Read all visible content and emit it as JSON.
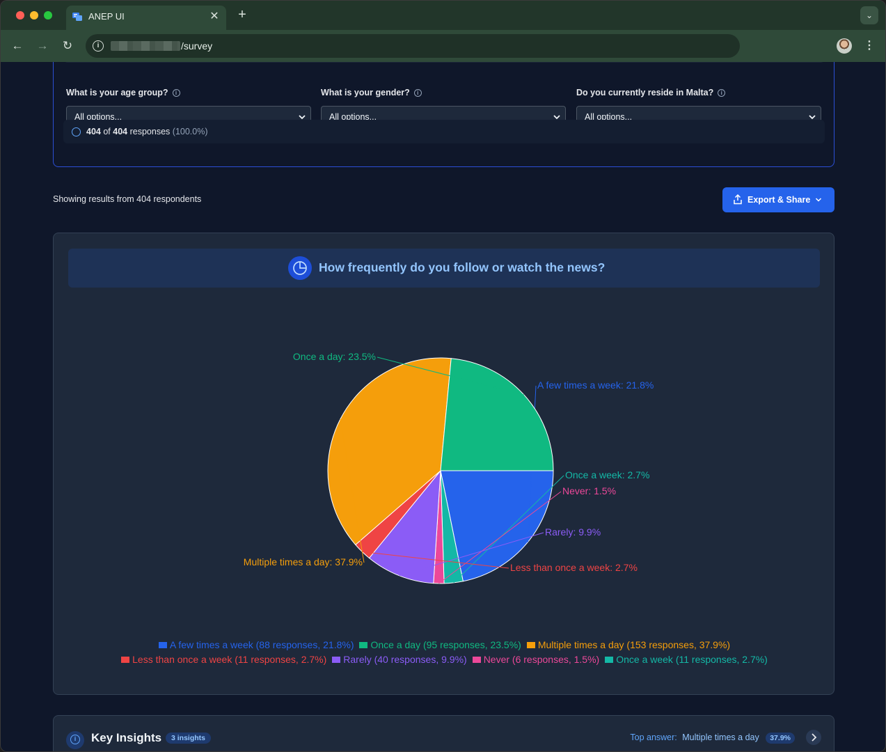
{
  "browser": {
    "tab_title": "ANEP UI",
    "url_path": "/survey"
  },
  "filters": [
    {
      "label": "What is your age group?",
      "value": "All options..."
    },
    {
      "label": "What is your gender?",
      "value": "All options..."
    },
    {
      "label": "Do you currently reside in Malta?",
      "value": "All options..."
    }
  ],
  "responses": {
    "count": "404",
    "of": "of",
    "total": "404",
    "suffix": "responses",
    "percent": "(100.0%)"
  },
  "results": {
    "showing_text": "Showing results from 404 respondents",
    "export_label": "Export & Share"
  },
  "question": {
    "title": "How frequently do you follow or watch the news?"
  },
  "chart_data": {
    "type": "pie",
    "slices": [
      {
        "label": "A few times a week",
        "value": 21.8,
        "responses": 88,
        "color": "#2563eb",
        "slice_label": "A few times a week: 21.8%",
        "legend": "A few times a week (88 responses, 21.8%)"
      },
      {
        "label": "Once a week",
        "value": 2.7,
        "responses": 11,
        "color": "#14b8a6",
        "slice_label": "Once a week: 2.7%",
        "legend": "Once a week (11 responses, 2.7%)"
      },
      {
        "label": "Never",
        "value": 1.5,
        "responses": 6,
        "color": "#ec4899",
        "slice_label": "Never: 1.5%",
        "legend": "Never (6 responses, 1.5%)"
      },
      {
        "label": "Rarely",
        "value": 9.9,
        "responses": 40,
        "color": "#8b5cf6",
        "slice_label": "Rarely: 9.9%",
        "legend": "Rarely (40 responses, 9.9%)"
      },
      {
        "label": "Less than once a week",
        "value": 2.7,
        "responses": 11,
        "color": "#ef4444",
        "slice_label": "Less than once a week: 2.7%",
        "legend": "Less than once a week (11 responses, 2.7%)"
      },
      {
        "label": "Multiple times a day",
        "value": 37.9,
        "responses": 153,
        "color": "#f59e0b",
        "slice_label": "Multiple times a day: 37.9%",
        "legend": "Multiple times a day (153 responses, 37.9%)"
      },
      {
        "label": "Once a day",
        "value": 23.5,
        "responses": 95,
        "color": "#10b981",
        "slice_label": "Once a day: 23.5%",
        "legend": "Once a day (95 responses, 23.5%)"
      }
    ],
    "legend_order": [
      [
        "A few times a week",
        "Once a day",
        "Multiple times a day"
      ],
      [
        "Less than once a week",
        "Rarely",
        "Never",
        "Once a week"
      ]
    ]
  },
  "insights": {
    "title": "Key Insights",
    "badge": "3 insights",
    "top_answer_label": "Top answer:",
    "top_answer_value": "Multiple times a day",
    "top_answer_percent": "37.9%"
  }
}
